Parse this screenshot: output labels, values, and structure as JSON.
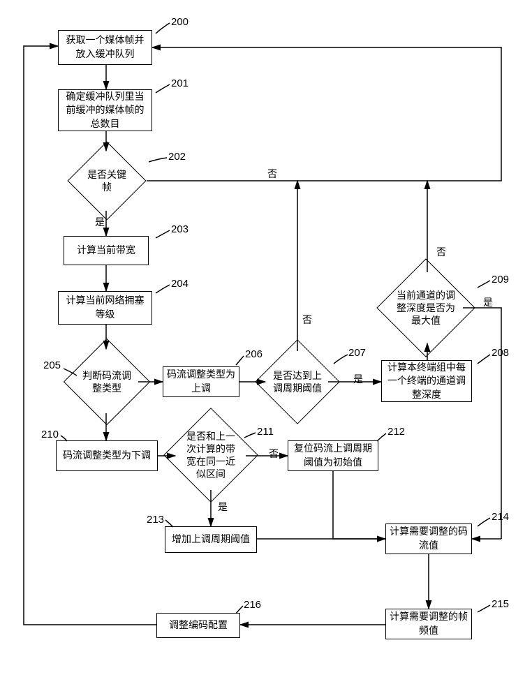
{
  "nodes": {
    "n200": "获取一个媒体帧并放入缓冲队列",
    "n201": "确定缓冲队列里当前缓冲的媒体帧的总数目",
    "n202": "是否关键帧",
    "n203": "计算当前带宽",
    "n204": "计算当前网络拥塞等级",
    "n205": "判断码流调整类型",
    "n206": "码流调整类型为上调",
    "n207": "是否达到上调周期阈值",
    "n208": "计算本终端组中每一个终端的通道调整深度",
    "n209": "当前通道的调整深度是否为最大值",
    "n210": "码流调整类型为下调",
    "n211": "是否和上一次计算的带宽在同一近似区间",
    "n212": "复位码流上调周期阈值为初始值",
    "n213": "增加上调周期阈值",
    "n214": "计算需要调整的码流值",
    "n215": "计算需要调整的帧频值",
    "n216": "调整编码配置"
  },
  "nums": {
    "c200": "200",
    "c201": "201",
    "c202": "202",
    "c203": "203",
    "c204": "204",
    "c205": "205",
    "c206": "206",
    "c207": "207",
    "c208": "208",
    "c209": "209",
    "c210": "210",
    "c211": "211",
    "c212": "212",
    "c213": "213",
    "c214": "214",
    "c215": "215",
    "c216": "216"
  },
  "labels": {
    "yes": "是",
    "no": "否"
  }
}
